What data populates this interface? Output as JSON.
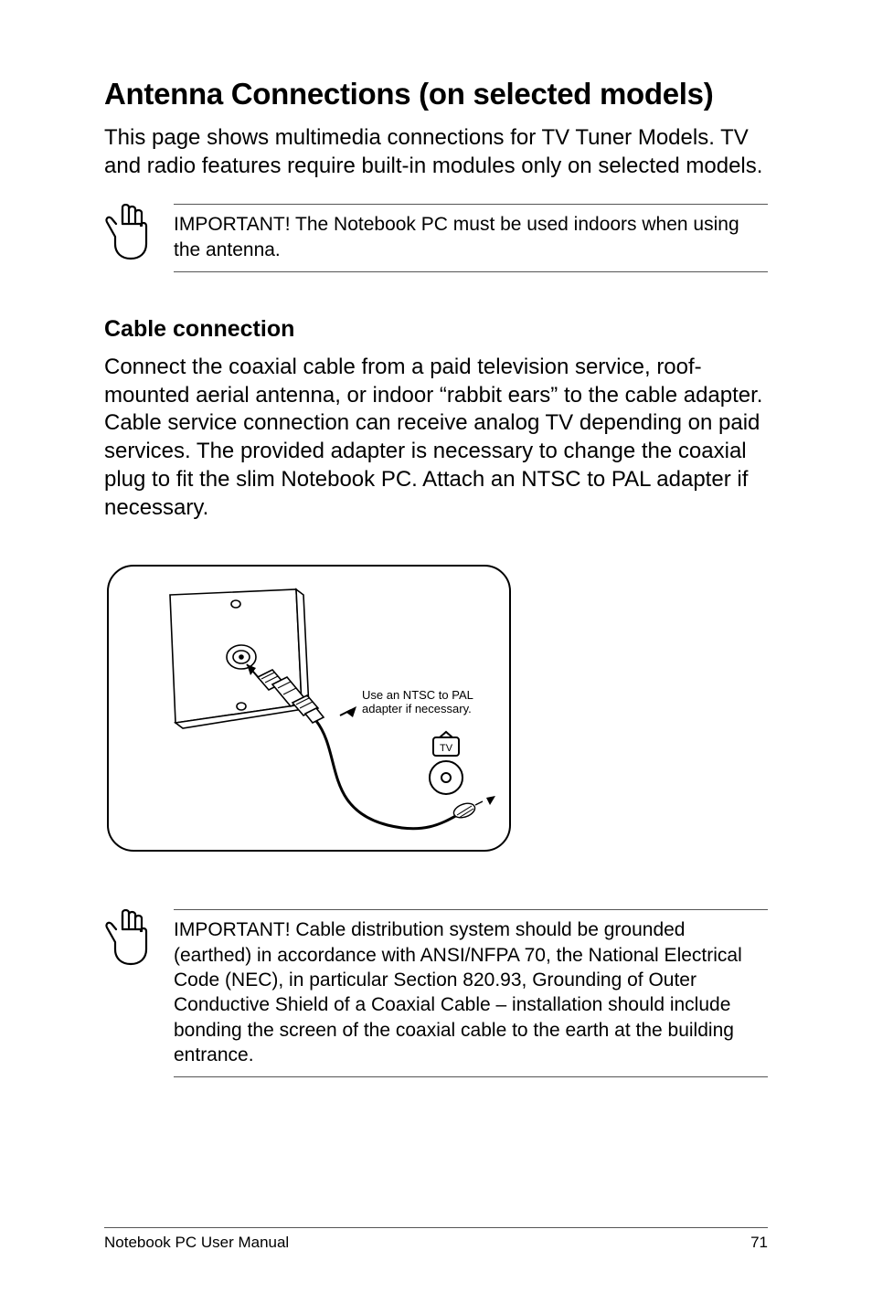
{
  "heading": "Antenna Connections (on selected models)",
  "intro": "This page shows multimedia connections for TV Tuner Models. TV and radio features require built-in modules only on selected models.",
  "note1": "IMPORTANT! The Notebook PC must be used indoors when using the antenna.",
  "subheading": "Cable connection",
  "body": "Connect the coaxial cable from a paid television service, roof-mounted aerial antenna, or indoor “rabbit ears” to the cable adapter. Cable service connection can receive analog TV depending on paid services. The provided adapter is necessary to change the coaxial plug to fit the slim Notebook PC. Attach an NTSC to PAL adapter if necessary.",
  "diagram_label_line1": "Use an NTSC to PAL",
  "diagram_label_line2": "adapter if necessary.",
  "note2": "IMPORTANT!  Cable distribution system should be grounded (earthed) in accordance with ANSI/NFPA 70, the National Electrical Code (NEC), in particular Section 820.93, Grounding of Outer Conductive Shield of a Coaxial Cable – installation should include bonding the screen of the coaxial cable to the earth at the building entrance.",
  "footer_left": "Notebook PC User Manual",
  "footer_right": "71"
}
